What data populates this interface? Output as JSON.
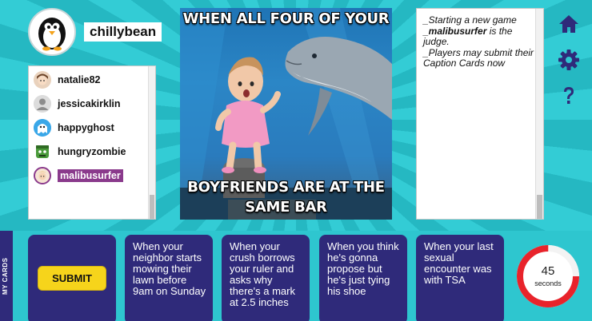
{
  "user": {
    "username": "chillybean",
    "avatar_icon": "penguin-icon"
  },
  "players": [
    {
      "name": "natalie82",
      "avatar_icon": "girl-avatar-icon",
      "is_judge": false
    },
    {
      "name": "jessicakirklin",
      "avatar_icon": "default-user-icon",
      "is_judge": false
    },
    {
      "name": "happyghost",
      "avatar_icon": "ghost-avatar-icon",
      "is_judge": false
    },
    {
      "name": "hungryzombie",
      "avatar_icon": "zombie-avatar-icon",
      "is_judge": false
    },
    {
      "name": "malibusurfer",
      "avatar_icon": "surfer-avatar-icon",
      "is_judge": true
    }
  ],
  "meme": {
    "top_text": "WHEN ALL FOUR OF YOUR",
    "bottom_text_line1": "BOYFRIENDS ARE AT THE",
    "bottom_text_line2": "SAME BAR",
    "image": "girl-and-dolphin-photo"
  },
  "log": {
    "lines": [
      "_Starting a new game",
      "_malibusurfer is the judge.",
      "_Players may submit their Caption Cards now"
    ],
    "line2_user": "_malibusurfer",
    "line2_rest": " is the judge."
  },
  "side_icons": [
    "home-icon",
    "gear-icon",
    "help-icon"
  ],
  "cards_bar": {
    "tab_label": "MY CARDS",
    "submit_label": "SUBMIT",
    "cards": [
      "When your neighbor starts mowing their lawn before 9am on Sunday",
      "When your crush borrows your ruler and asks why there's a mark at 2.5 inches",
      "When you think he's gonna propose but he's just tying his shoe",
      "When your last sexual encounter was with TSA"
    ]
  },
  "timer": {
    "value": "45",
    "unit": "seconds",
    "fraction_remaining": 0.75,
    "color": "#e8232b"
  }
}
